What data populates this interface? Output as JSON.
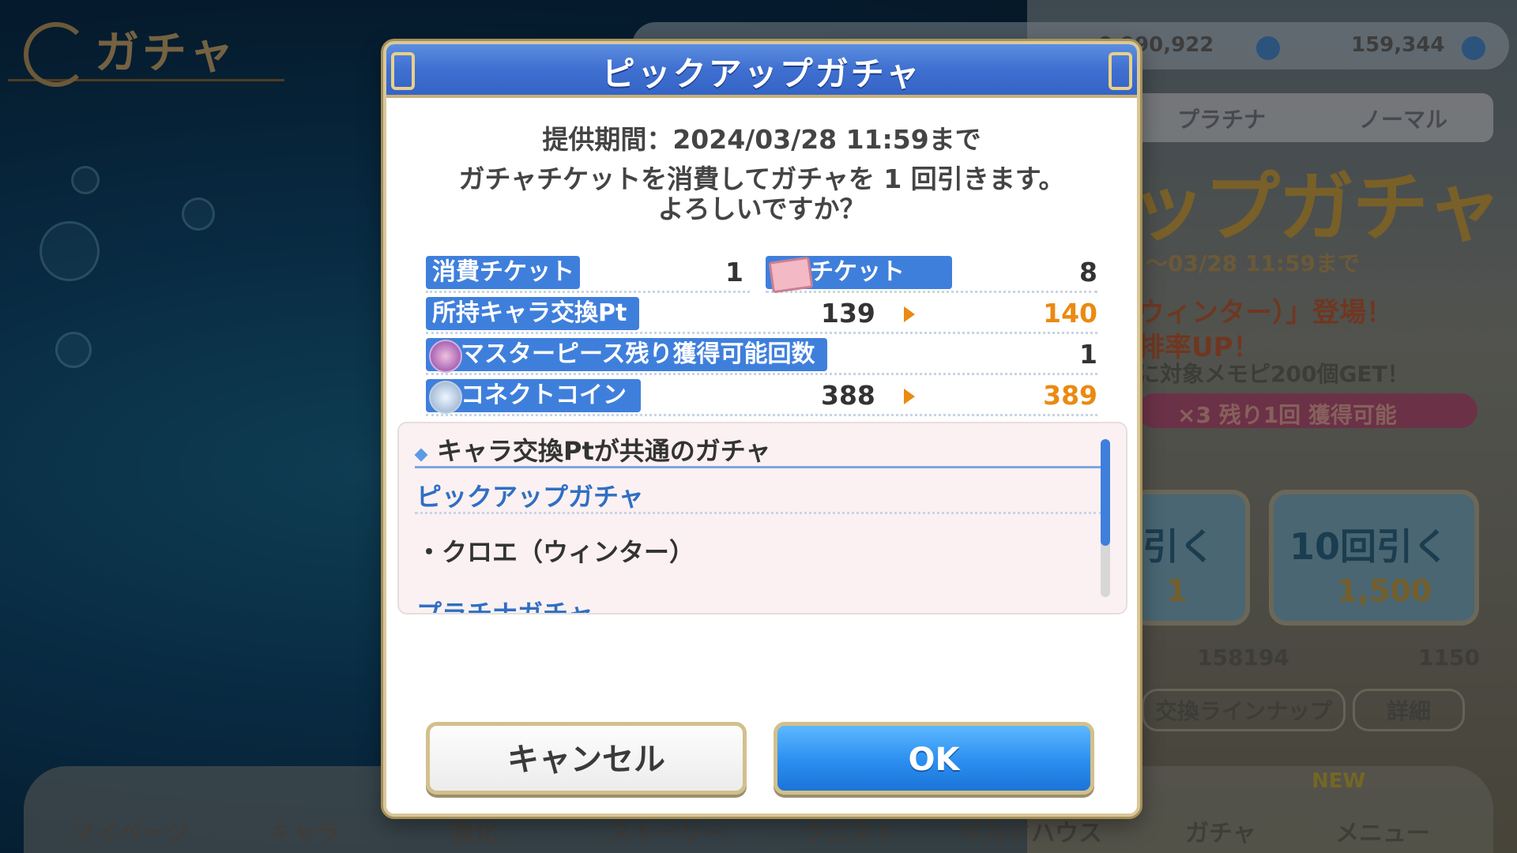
{
  "background": {
    "screen_title": "ガチャ",
    "currencies": [
      "0,990,922",
      "159,344"
    ],
    "tabs": [
      "プラチナ",
      "ノーマル"
    ],
    "banner_title": "ップガチャ",
    "banner_period": "〜03/28 11:59まで",
    "banner_lines": [
      "ウィンター）」登場！",
      "排率UP！",
      "に対象メモピ200個GET！"
    ],
    "pink_bar": "×3 残り1回 獲得可能",
    "draw1_label": "引く",
    "draw1_cost": "1",
    "draw10_label": "10回引く",
    "draw10_cost": "1,500",
    "counts": [
      "158194",
      "1150"
    ],
    "exchange_button": "交換ラインナップ",
    "detail_button": "詳細",
    "new_badge": "NEW",
    "nav": [
      "マイページ",
      "キャラ",
      "強化",
      "ストーリー",
      "クエスト",
      "ギルドハウス",
      "ガチャ",
      "メニュー"
    ]
  },
  "dialog": {
    "title": "ピックアップガチャ",
    "period": "提供期間：2024/03/28 11:59まで",
    "confirm_line1": "ガチャチケットを消費してガチャを 1 回引きます。",
    "confirm_line2": "よろしいですか？",
    "rows": {
      "consume_label": "消費チケット",
      "consume_value": "1",
      "ticket_label": "チケット",
      "ticket_value": "8",
      "pt_label": "所持キャラ交換Pt",
      "pt_before": "139",
      "pt_after": "140",
      "mp_label": "マスターピース残り獲得可能回数",
      "mp_value": "1",
      "coin_label": "コネクトコイン",
      "coin_before": "388",
      "coin_after": "389"
    },
    "shared": {
      "heading": "キャラ交換Ptが共通のガチャ",
      "gacha1": "ピックアップガチャ",
      "chara1": "・クロエ（ウィンター）",
      "gacha2": "プラチナガチャ"
    },
    "cancel_label": "キャンセル",
    "ok_label": "OK"
  },
  "colors": {
    "accent_blue": "#3f7fdc",
    "orange": "#ea8a12",
    "gold_border": "#d2c08c"
  }
}
